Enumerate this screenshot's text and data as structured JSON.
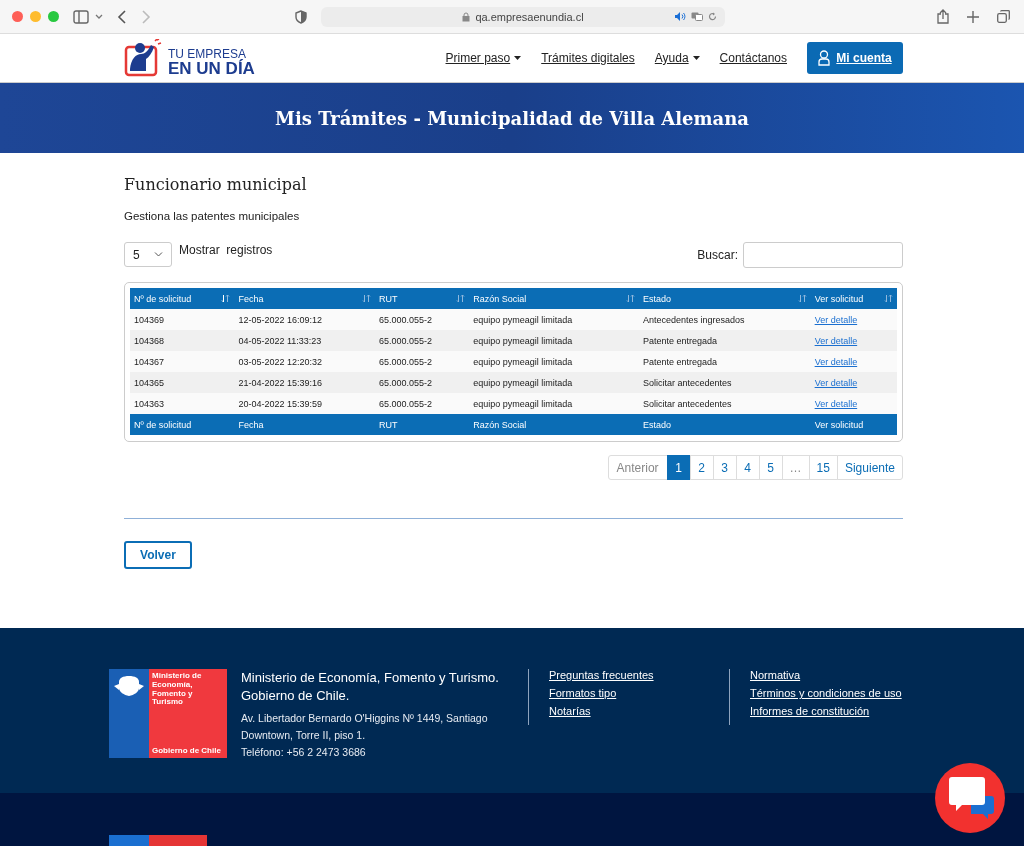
{
  "browser": {
    "url": "qa.empresaenundia.cl"
  },
  "header": {
    "logo": {
      "line_1": "TU EMPRESA",
      "line_2": "EN UN DÍA"
    },
    "nav": [
      {
        "label": "Primer paso",
        "dropdown": true
      },
      {
        "label": "Trámites digitales",
        "dropdown": false
      },
      {
        "label": "Ayuda",
        "dropdown": true
      },
      {
        "label": "Contáctanos",
        "dropdown": false
      }
    ],
    "account_button": "Mi cuenta"
  },
  "banner": {
    "title": "Mis Trámites - Municipalidad de Villa Alemana"
  },
  "main": {
    "title": "Funcionario municipal",
    "subtitle": "Gestiona las patentes municipales",
    "page_size": "5",
    "page_size_label": "Mostrar  registros",
    "search_label": "Buscar:",
    "table": {
      "columns": [
        {
          "label": "Nº de solicitud",
          "sorted": true
        },
        {
          "label": "Fecha",
          "sorted": false
        },
        {
          "label": "RUT",
          "sorted": false
        },
        {
          "label": "Razón Social",
          "sorted": false
        },
        {
          "label": "Estado",
          "sorted": false
        },
        {
          "label": "Ver solicitud",
          "sorted": false
        }
      ],
      "rows": [
        [
          "104369",
          "12-05-2022 16:09:12",
          "65.000.055-2",
          "equipo pymeagil limitada",
          "Antecedentes ingresados",
          "Ver detalle"
        ],
        [
          "104368",
          "04-05-2022 11:33:23",
          "65.000.055-2",
          "equipo pymeagil limitada",
          "Patente entregada",
          "Ver detalle"
        ],
        [
          "104367",
          "03-05-2022 12:20:32",
          "65.000.055-2",
          "equipo pymeagil limitada",
          "Patente entregada",
          "Ver detalle"
        ],
        [
          "104365",
          "21-04-2022 15:39:16",
          "65.000.055-2",
          "equipo pymeagil limitada",
          "Solicitar antecedentes",
          "Ver detalle"
        ],
        [
          "104363",
          "20-04-2022 15:39:59",
          "65.000.055-2",
          "equipo pymeagil limitada",
          "Solicitar antecedentes",
          "Ver detalle"
        ]
      ],
      "footer": [
        "Nº de solicitud",
        "Fecha",
        "RUT",
        "Razón Social",
        "Estado",
        "Ver solicitud"
      ]
    },
    "pagination": [
      {
        "label": "Anterior",
        "selected": false,
        "disabled": true
      },
      {
        "label": "1",
        "selected": true,
        "disabled": false
      },
      {
        "label": "2",
        "selected": false,
        "disabled": false
      },
      {
        "label": "3",
        "selected": false,
        "disabled": false
      },
      {
        "label": "4",
        "selected": false,
        "disabled": false
      },
      {
        "label": "5",
        "selected": false,
        "disabled": false
      },
      {
        "label": "…",
        "selected": false,
        "disabled": true
      },
      {
        "label": "15",
        "selected": false,
        "disabled": false
      },
      {
        "label": "Siguiente",
        "selected": false,
        "disabled": false
      }
    ],
    "back_button": "Volver"
  },
  "footer": {
    "gov_logo": {
      "ministry": "Ministerio de Economía, Fomento y Turismo",
      "government": "Gobierno de Chile"
    },
    "org_name": "Ministerio de Economía, Fomento y Turismo. Gobierno de Chile.",
    "address": "Av. Libertador Bernardo O'Higgins Nº 1449, Santiago Downtown, Torre II, piso 1.",
    "phone": "Teléfono: +56 2 2473 3686",
    "links_1": [
      "Preguntas frecuentes",
      "Formatos tipo",
      "Notarías"
    ],
    "links_2": [
      "Normativa",
      "Términos y condiciones de uso",
      "Informes de constitución"
    ]
  }
}
